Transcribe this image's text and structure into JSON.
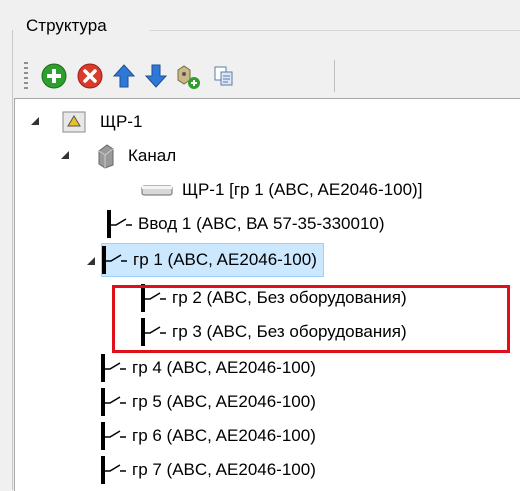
{
  "panel": {
    "title": "Структура"
  },
  "toolbar": {
    "buttons": [
      {
        "name": "add-button",
        "icon": "green-plus-icon"
      },
      {
        "name": "delete-button",
        "icon": "red-x-icon"
      },
      {
        "name": "move-up-button",
        "icon": "blue-up-arrow-icon"
      },
      {
        "name": "move-down-button",
        "icon": "blue-down-arrow-icon"
      },
      {
        "name": "add-equipment-button",
        "icon": "device-add-icon"
      },
      {
        "name": "copy-button",
        "icon": "copy-icon"
      }
    ]
  },
  "tree": {
    "root": "ЩР-1",
    "channel": "Канал",
    "busbar": "ЩР-1 [гр 1 (ABC, AE2046-100)]",
    "input": "Ввод 1 (ABC, ВА 57-35-330010)",
    "group1": "гр 1 (ABC, AE2046-100)",
    "group2": "гр 2 (ABC, Без оборудования)",
    "group3": "гр 3 (ABC, Без оборудования)",
    "group4": "гр 4 (ABC, AE2046-100)",
    "group5": "гр 5 (ABC, AE2046-100)",
    "group6": "гр 6 (ABC, AE2046-100)",
    "group7": "гр 7 (ABC, AE2046-100)"
  },
  "colors": {
    "selection": "#cce8ff",
    "highlight": "#e0101a"
  }
}
